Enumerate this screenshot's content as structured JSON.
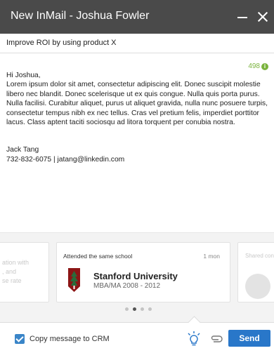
{
  "header": {
    "title": "New InMail - Joshua Fowler"
  },
  "subject": "Improve ROI by using product X",
  "counter": "498",
  "message": {
    "greeting": "Hi Joshua,",
    "body": "Lorem ipsum dolor sit amet, consectetur adipiscing elit. Donec suscipit molestie libero nec blandit. Donec scelerisque ut ex quis congue. Nulla quis porta purus. Nulla facilisi. Curabitur aliquet, purus ut aliquet gravida, nulla nunc posuere turpis, consectetur tempus nibh ex nec tellus. Cras vel pretium felis, imperdiet porttitor lacus. Class aptent taciti sociosqu ad litora torquent per conubia nostra.",
    "signature_name": "Jack Tang",
    "signature_contact": "732-832-6075 | jatang@linkedin.com"
  },
  "cards": {
    "left_ghost": "ation with\n, and\nse rate",
    "main": {
      "caption": "Attended the same school",
      "time": "1 mon",
      "school": "Stanford University",
      "degree": "MBA/MA  2008 - 2012",
      "logo_color": "#8c1515"
    },
    "right_ghost": "Shared con"
  },
  "pagination": {
    "total": 4,
    "active": 2
  },
  "footer": {
    "crm_label": "Copy message to CRM",
    "crm_checked": true,
    "send_label": "Send",
    "accent": "#2977c9",
    "tip_icon": "lightbulb-icon",
    "attach_icon": "paperclip-icon"
  }
}
